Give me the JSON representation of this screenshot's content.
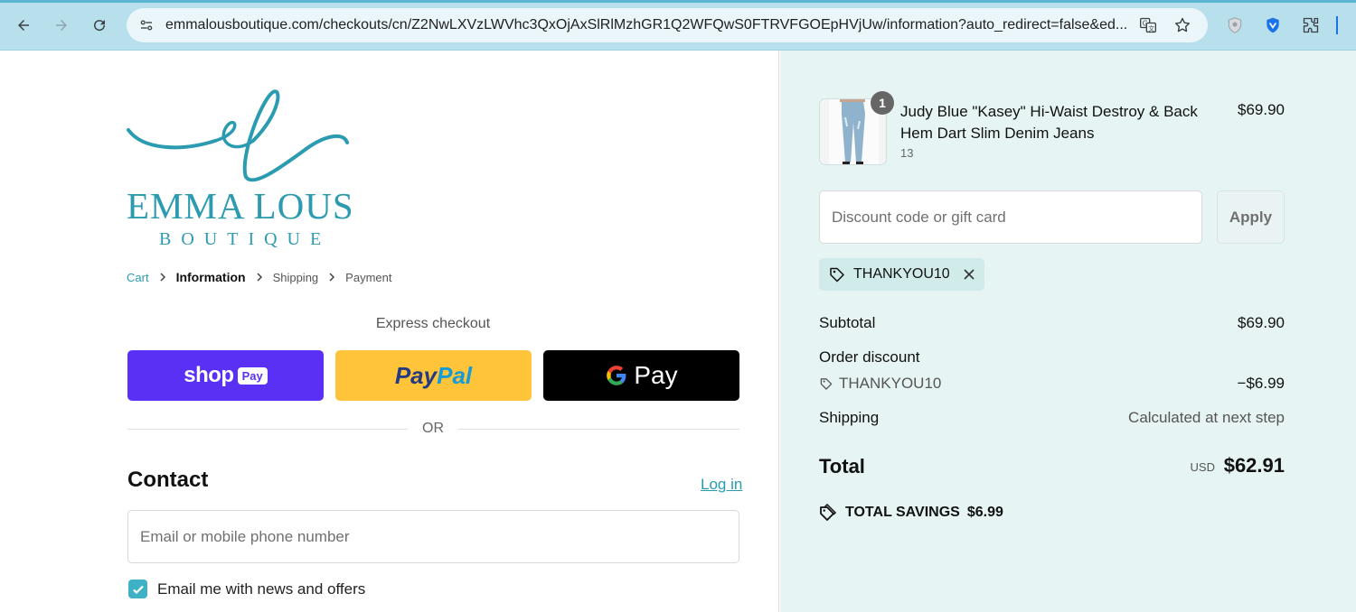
{
  "browser": {
    "url": "emmalousboutique.com/checkouts/cn/Z2NwLXVzLWVhc3QxOjAxSlRlMzhGR1Q2WFQwS0FTRVFGOEpHVjUw/information?auto_redirect=false&ed..."
  },
  "logo": {
    "name": "EMMA LOUS",
    "sub": "BOUTIQUE"
  },
  "breadcrumb": {
    "cart": "Cart",
    "information": "Information",
    "shipping": "Shipping",
    "payment": "Payment"
  },
  "express": {
    "title": "Express checkout",
    "shop_pay": "shop",
    "shop_pay_badge": "Pay",
    "paypal_1": "Pay",
    "paypal_2": "Pal",
    "gpay": "Pay",
    "or": "OR"
  },
  "contact": {
    "title": "Contact",
    "login": "Log in",
    "email_placeholder": "Email or mobile phone number",
    "newsletter_label": "Email me with news and offers",
    "newsletter_checked": true
  },
  "order": {
    "item": {
      "quantity": "1",
      "name": "Judy Blue \"Kasey\" Hi-Waist Destroy & Back Hem Dart Slim Denim Jeans",
      "variant": "13",
      "price": "$69.90"
    },
    "discount_placeholder": "Discount code or gift card",
    "apply_label": "Apply",
    "applied_code": "THANKYOU10",
    "subtotal_label": "Subtotal",
    "subtotal_value": "$69.90",
    "order_discount_label": "Order discount",
    "order_discount_code": "THANKYOU10",
    "order_discount_value": "−$6.99",
    "shipping_label": "Shipping",
    "shipping_value": "Calculated at next step",
    "total_label": "Total",
    "total_currency": "USD",
    "total_value": "$62.91",
    "savings_label": "TOTAL SAVINGS",
    "savings_value": "$6.99"
  },
  "colors": {
    "accent": "#2a9bb0",
    "shop_pay": "#5a31f4",
    "paypal": "#ffc439",
    "summary_bg": "#e6f4f3"
  }
}
